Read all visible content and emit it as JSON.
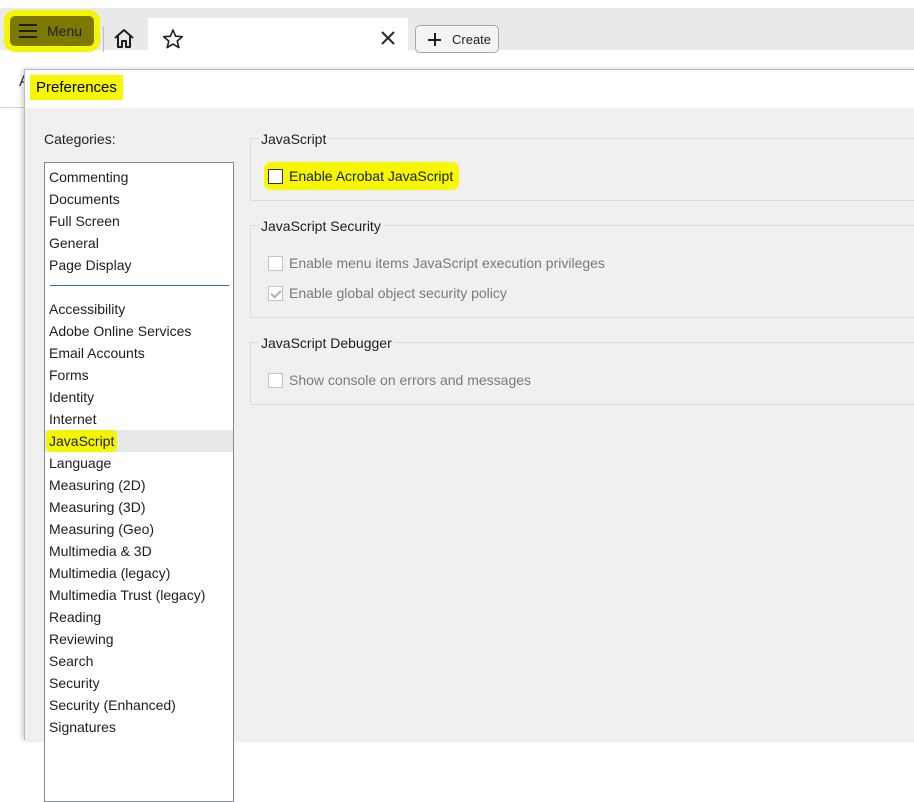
{
  "toolbar": {
    "menu_label": "Menu",
    "create_label": "Create",
    "tab_title": ""
  },
  "background": {
    "partial_letter": "A"
  },
  "dialog": {
    "title": "Preferences",
    "categories_label": "Categories:",
    "categories_top": [
      "Commenting",
      "Documents",
      "Full Screen",
      "General",
      "Page Display"
    ],
    "categories": [
      "Accessibility",
      "Adobe Online Services",
      "Email Accounts",
      "Forms",
      "Identity",
      "Internet",
      "JavaScript",
      "Language",
      "Measuring (2D)",
      "Measuring (3D)",
      "Measuring (Geo)",
      "Multimedia & 3D",
      "Multimedia (legacy)",
      "Multimedia Trust (legacy)",
      "Reading",
      "Reviewing",
      "Search",
      "Security",
      "Security (Enhanced)",
      "Signatures"
    ],
    "selected_category": "JavaScript",
    "groups": {
      "javascript": {
        "title": "JavaScript",
        "enable_label": "Enable Acrobat JavaScript",
        "enable_checked": false
      },
      "security": {
        "title": "JavaScript Security",
        "menu_items_label": "Enable menu items JavaScript execution privileges",
        "menu_items_checked": false,
        "global_policy_label": "Enable global object security policy",
        "global_policy_checked": true
      },
      "debugger": {
        "title": "JavaScript Debugger",
        "console_label": "Show console on errors and messages",
        "console_checked": false
      }
    }
  },
  "colors": {
    "highlight": "#f5f500",
    "menu_button": "#7d7800",
    "list_divider": "#2d6fa8"
  }
}
